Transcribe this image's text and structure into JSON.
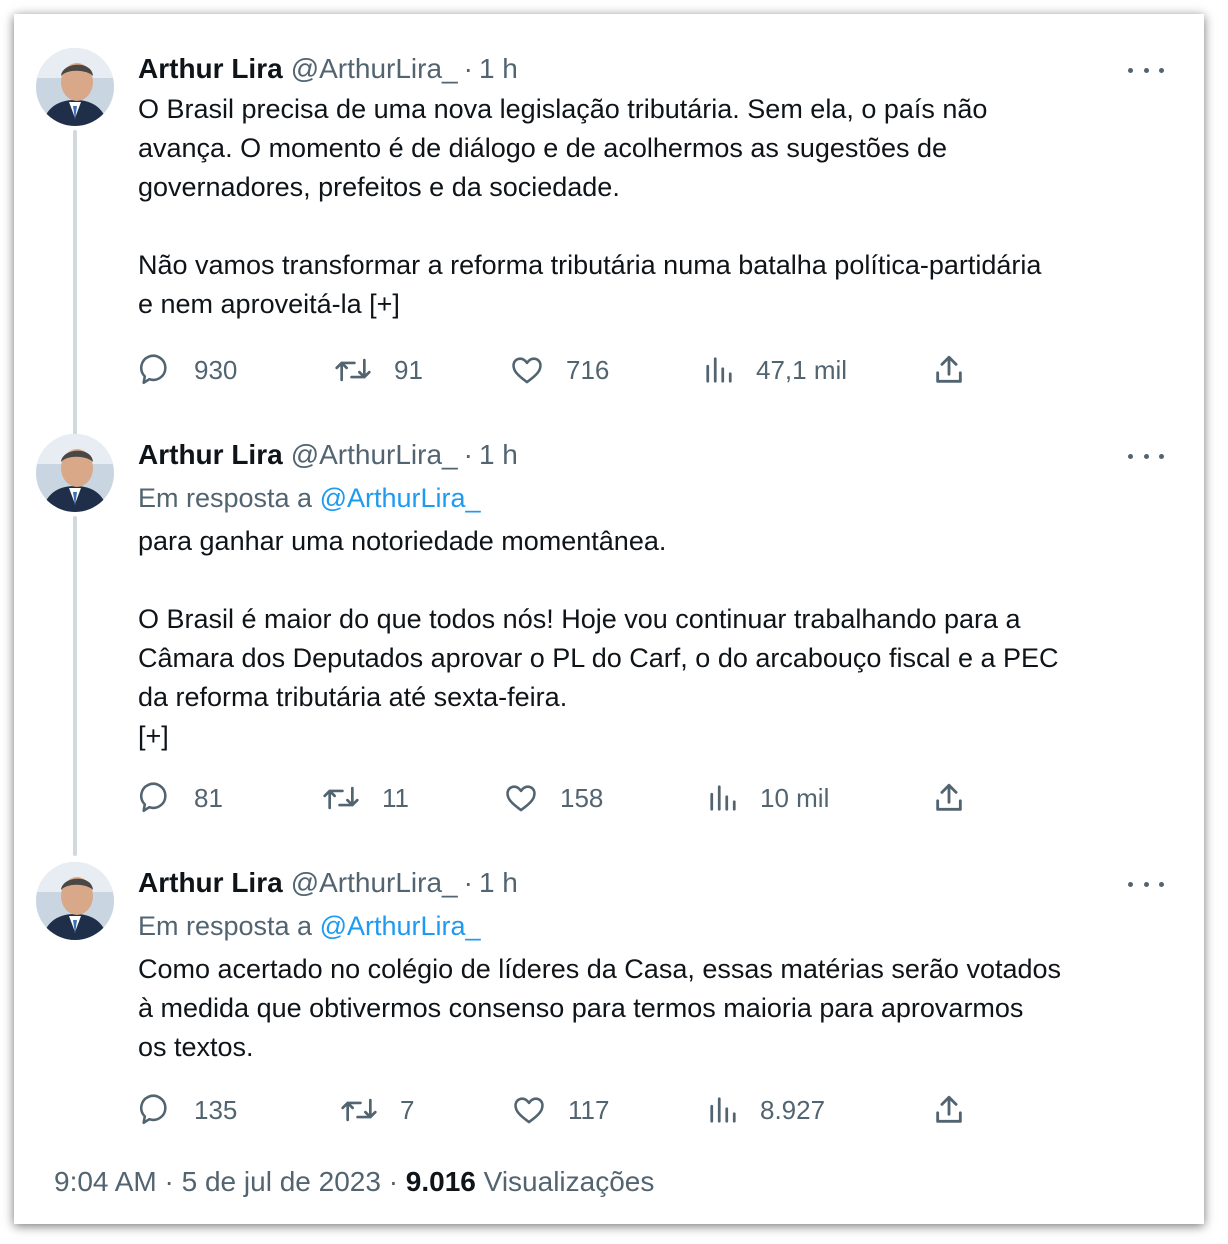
{
  "tweets": [
    {
      "name": "Arthur Lira",
      "handle": "@ArthurLira_",
      "time": "1 h",
      "replying_prefix": "",
      "replying_handle": "",
      "text": "O Brasil precisa de uma nova legislação tributária. Sem ela, o país não\navança. O momento é de diálogo e de acolhermos as sugestões de\ngovernadores, prefeitos e da sociedade.\n\nNão vamos transformar a reforma tributária numa batalha política-partidária\ne nem aproveitá-la [+]",
      "stats": {
        "replies": "930",
        "retweets": "91",
        "likes": "716",
        "views": "47,1 mil"
      }
    },
    {
      "name": "Arthur Lira",
      "handle": "@ArthurLira_",
      "time": "1 h",
      "replying_prefix": "Em resposta a",
      "replying_handle": "@ArthurLira_",
      "text": "para ganhar uma notoriedade momentânea.\n\nO Brasil é maior do que todos nós! Hoje vou continuar trabalhando para a\nCâmara dos Deputados aprovar o PL do Carf, o do arcabouço fiscal e a PEC\nda reforma tributária até sexta-feira.\n[+]",
      "stats": {
        "replies": "81",
        "retweets": "11",
        "likes": "158",
        "views": "10 mil"
      }
    },
    {
      "name": "Arthur Lira",
      "handle": "@ArthurLira_",
      "time": "1 h",
      "replying_prefix": "Em resposta a",
      "replying_handle": "@ArthurLira_",
      "text": "Como acertado no colégio de líderes da Casa, essas matérias serão votados\nà medida que obtivermos consenso para termos maioria para aprovarmos\nos textos.",
      "stats": {
        "replies": "135",
        "retweets": "7",
        "likes": "117",
        "views": "8.927"
      }
    }
  ],
  "footer": {
    "time": "9:04 AM",
    "date": "5 de jul de 2023",
    "views_count": "9.016",
    "views_label": "Visualizações"
  },
  "colors": {
    "text": "#0f1419",
    "muted": "#536471",
    "link": "#1d9bf0",
    "thread_line": "#cfd9de"
  },
  "icons": [
    "more-icon",
    "reply-icon",
    "retweet-icon",
    "like-icon",
    "views-icon",
    "share-icon"
  ]
}
